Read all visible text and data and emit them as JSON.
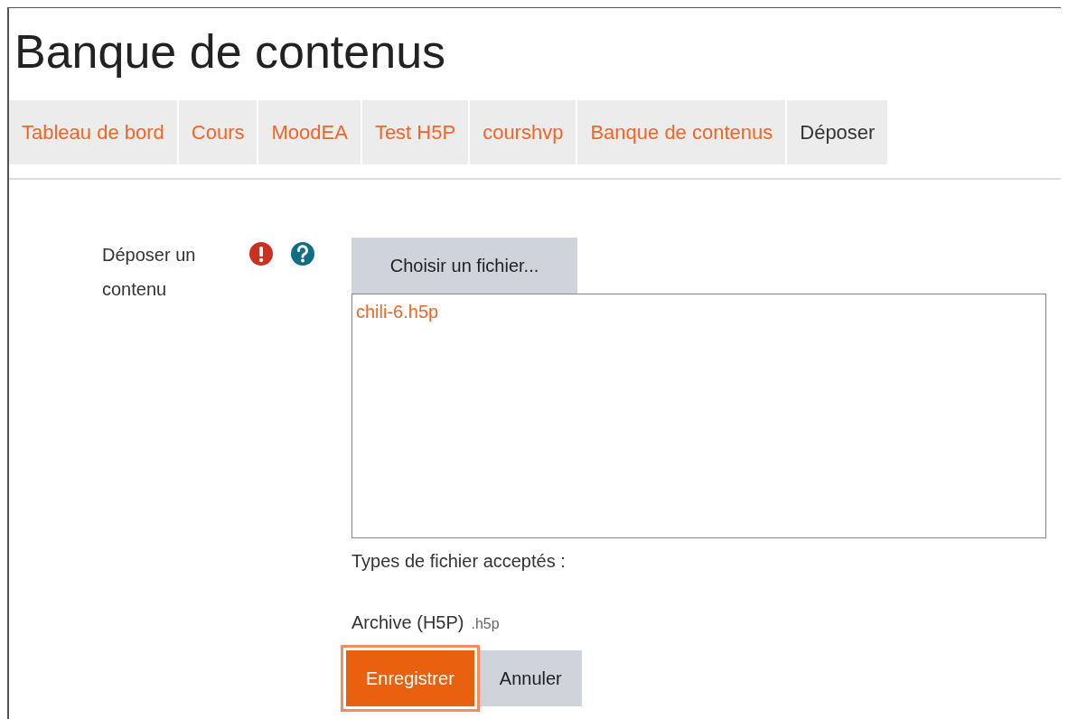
{
  "page_title": "Banque de contenus",
  "breadcrumb": [
    {
      "label": "Tableau de bord",
      "current": false
    },
    {
      "label": "Cours",
      "current": false
    },
    {
      "label": "MoodEA",
      "current": false
    },
    {
      "label": "Test H5P",
      "current": false
    },
    {
      "label": "courshvp",
      "current": false
    },
    {
      "label": "Banque de contenus",
      "current": false
    },
    {
      "label": "Déposer",
      "current": true
    }
  ],
  "form": {
    "label": "Déposer un contenu",
    "choose_button": "Choisir un fichier...",
    "files": [
      "chili-6.h5p"
    ],
    "accepted_label": "Types de fichier acceptés :",
    "accepted_type": "Archive (H5P)",
    "accepted_ext": ".h5p"
  },
  "buttons": [
    {
      "label": "Enregistrer",
      "kind": "primary",
      "focused": true
    },
    {
      "label": "Annuler",
      "kind": "secondary",
      "focused": false
    }
  ]
}
